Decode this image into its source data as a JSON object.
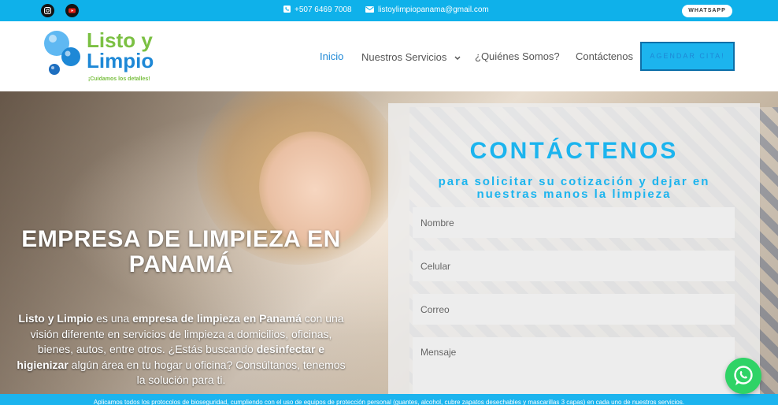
{
  "topbar": {
    "phone": "+507 6469 7008",
    "email": "listoylimpiopanama@gmail.com",
    "whatsapp_label": "WHATSAPP",
    "social": [
      "instagram-icon",
      "youtube-icon"
    ]
  },
  "header": {
    "logo_line1": "Listo y",
    "logo_line2": "Limpio",
    "logo_tagline": "¡Cuidamos los detalles!",
    "nav": {
      "inicio": "Inicio",
      "servicios": "Nuestros Servicios",
      "quienes": "¿Quiénes Somos?",
      "contacto": "Contáctenos"
    },
    "cta": "AGENDAR CITA!"
  },
  "hero": {
    "title": "EMPRESA DE LIMPIEZA EN PANAMÁ",
    "text_parts": {
      "p1": "Listo y Limpio",
      "p2": "  es una ",
      "p3": "empresa de limpieza en Panamá",
      "p4": " con una visión diferente en servicios de limpieza a domicilios, oficinas, bienes, autos, entre otros. ¿Estás buscando ",
      "p5": "desinfectar e higienizar",
      "p6": " algún área en tu hogar u oficina? Consúltanos, tenemos la solución para ti."
    }
  },
  "form": {
    "title": "CONTÁCTENOS",
    "subtitle": "para solicitar su cotización y dejar en nuestras manos la limpieza",
    "placeholders": {
      "nombre": "Nombre",
      "celular": "Celular",
      "correo": "Correo",
      "mensaje": "Mensaje"
    }
  },
  "footer_strip": "Aplicamos todos los protocolos de bioseguridad, cumpliendo con el uso de equipos de protección personal (guantes, alcohol, cubre zapatos desechables y mascarillas 3 capas) en cada uno de nuestros servicios.",
  "colors": {
    "accent": "#1cb4ee",
    "brand_blue": "#1e88d6",
    "brand_green": "#7bc043",
    "whatsapp": "#2fd366"
  }
}
